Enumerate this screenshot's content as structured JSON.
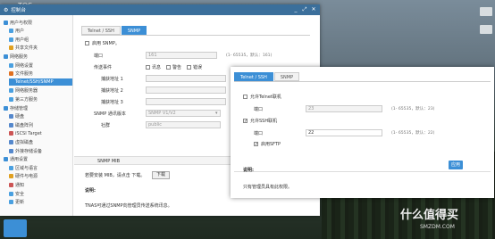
{
  "desktop": {
    "logo": "TOS",
    "watermark": "什么值得买",
    "watermark_sub": "SMZDM.COM"
  },
  "window": {
    "title": "控制台",
    "controls": [
      "_",
      "⤢",
      "✕"
    ]
  },
  "sidebar": {
    "items": [
      {
        "label": "用户与权限",
        "level": 0,
        "color": "#3c8fd6"
      },
      {
        "label": "用户",
        "level": 1,
        "color": "#4aa0e0"
      },
      {
        "label": "用户组",
        "level": 1,
        "color": "#4aa0e0"
      },
      {
        "label": "共享文件夹",
        "level": 1,
        "color": "#e0a020"
      },
      {
        "label": "网络服务",
        "level": 0,
        "color": "#3c8fd6"
      },
      {
        "label": "网络设置",
        "level": 1,
        "color": "#4aa0e0"
      },
      {
        "label": "文件服务",
        "level": 1,
        "color": "#e07020"
      },
      {
        "label": "Telnet/SSH/SNMP",
        "level": 1,
        "color": "#3c8fd6",
        "selected": true
      },
      {
        "label": "网络服务器",
        "level": 1,
        "color": "#4aa0e0"
      },
      {
        "label": "第三方服务",
        "level": 1,
        "color": "#4aa0e0"
      },
      {
        "label": "存储管理",
        "level": 0,
        "color": "#3c8fd6"
      },
      {
        "label": "硬盘",
        "level": 1,
        "color": "#5588cc"
      },
      {
        "label": "磁盘阵列",
        "level": 1,
        "color": "#5588cc"
      },
      {
        "label": "iSCSI Target",
        "level": 1,
        "color": "#cc5555"
      },
      {
        "label": "虚拟磁盘",
        "level": 1,
        "color": "#5588cc"
      },
      {
        "label": "外接存储设备",
        "level": 1,
        "color": "#5588cc"
      },
      {
        "label": "通用设置",
        "level": 0,
        "color": "#3c8fd6"
      },
      {
        "label": "区域与语言",
        "level": 1,
        "color": "#4aa0e0"
      },
      {
        "label": "硬件与电源",
        "level": 1,
        "color": "#e0a020"
      },
      {
        "label": "通知",
        "level": 1,
        "color": "#cc5555"
      },
      {
        "label": "安全",
        "level": 1,
        "color": "#4aa0e0"
      },
      {
        "label": "更新",
        "level": 1,
        "color": "#4aa0e0"
      }
    ]
  },
  "main": {
    "tabs": [
      "Telnet / SSH",
      "SNMP"
    ],
    "active_tab": 1,
    "enable_snmp": "启用 SNMP。",
    "port_label": "端口",
    "port_value": "161",
    "port_hint": "(1- 65535，默认：161)",
    "trap_label": "传送事件",
    "trap_options": [
      "讯息",
      "警告",
      "错误"
    ],
    "trap_addr_labels": [
      "捕获地址 1",
      "捕获地址 2",
      "捕获地址 3"
    ],
    "version_label": "SNMP 通讯版本",
    "version_value": "SNMP V1/V2",
    "community_label": "社群",
    "community_value": "public",
    "mib_section": "SNMP MIB",
    "mib_text": "若要安装 MIB，请点击 下载。",
    "download_button": "下载",
    "note_label": "说明:",
    "note_text": "TNAS可通过SNMP向管理员传送系统讯息。"
  },
  "dialog": {
    "tabs": [
      "Telnet / SSH",
      "SNMP"
    ],
    "active_tab": 0,
    "telnet_enable": "允许Telnet联机",
    "telnet_port_label": "端口",
    "telnet_port_value": "23",
    "telnet_port_hint": "(1- 65535，默认：23)",
    "ssh_enable": "允许SSH联机",
    "ssh_port_label": "端口",
    "ssh_port_value": "22",
    "ssh_port_hint": "(1- 65535，默认：22)",
    "sftp_enable": "启用SFTP",
    "apply_button": "应用",
    "note_label": "说明:",
    "note_text": "只有管理员具有此权限。"
  }
}
